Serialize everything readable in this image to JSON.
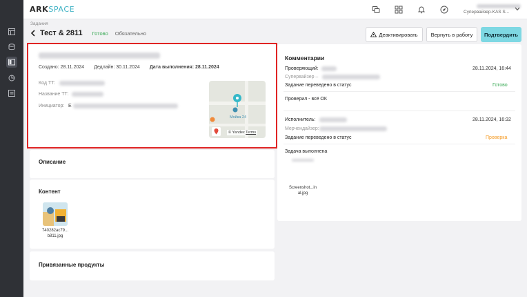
{
  "app": {
    "logo_main": "ARK",
    "logo_accent": "SPACE"
  },
  "user": {
    "role": "Супервайзер-KAS S..."
  },
  "icons": {
    "nav": [
      "dashboard-icon",
      "database-icon",
      "tasks-icon",
      "analytics-icon",
      "reports-icon"
    ],
    "top": [
      "chat-icon",
      "apps-grid-icon",
      "bell-icon",
      "compass-icon"
    ]
  },
  "header": {
    "breadcrumb": "Задания",
    "title": "Тест & 2811",
    "status": "Готово",
    "required": "Обязательно"
  },
  "actions": {
    "deactivate": "Деактивировать",
    "return_to_work": "Вернуть в работу",
    "confirm": "Подтвердить"
  },
  "task": {
    "created": "Создано: 28.11.2024",
    "deadline": "Дедлайн: 30.11.2024",
    "completed": "Дата выполнения: 28.11.2024",
    "fields": {
      "code_label": "Код ТТ:",
      "name_label": "Название ТТ:",
      "initiator_label": "Инициатор:",
      "initiator_prefix": "Е"
    },
    "map": {
      "place_label": "Мойка 24",
      "attribution": "© Yandex",
      "terms": "Terms"
    }
  },
  "sections": {
    "description": "Описание",
    "content": "Контент",
    "linked_products": "Привязанные продукты"
  },
  "content_file": {
    "name_line1": "740282ac79...",
    "name_line2": "b811.jpg"
  },
  "comments": {
    "title": "Комментарии",
    "entries": [
      {
        "role_label": "Проверяющий:",
        "sub_label": "Супервайзер –",
        "date": "28.11.2024, 16:44",
        "status_text": "Задание переведено в статус",
        "status_value": "Готово",
        "message": "Проверил - всё ОК"
      },
      {
        "role_label": "Исполнитель:",
        "sub_label": "Мерчендайзер:",
        "date": "28.11.2024, 16:32",
        "status_text": "Задание переведено в статус",
        "status_value": "Проверка",
        "message": "Задача выполнена",
        "attachment_line1": "Screenshot...in",
        "attachment_line2": "al.jpg"
      }
    ]
  },
  "colors": {
    "accent": "#7ed8e3",
    "status_done": "#36a852",
    "status_review": "#f59a23",
    "highlight": "#e02424",
    "sidebar": "#2f3136"
  }
}
